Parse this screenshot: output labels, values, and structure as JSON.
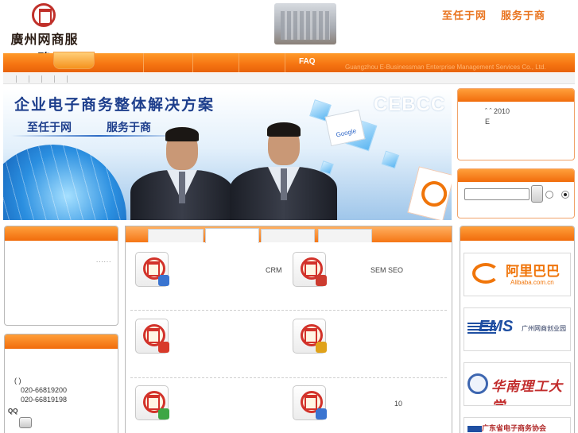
{
  "header": {
    "logo_text": "廣州网商服務",
    "slogan": [
      "至任于网",
      "服务于商"
    ]
  },
  "nav": {
    "faq": "FAQ",
    "tagline": "Guangzhou E-Businessman Enterprise Management Services Co., Ltd."
  },
  "banner": {
    "title": "企业电子商务整体解决方案",
    "sub": [
      "至任于网",
      "服务于商"
    ],
    "watermark": "CEBCC",
    "google": "Google"
  },
  "news": {
    "line1": "ˆ ˆ 2010",
    "line2": "E"
  },
  "left": {
    "more": "......",
    "contact_paren": "(    )",
    "phone1": "020-66819200",
    "phone2": "020-66819198",
    "qq": "QQ"
  },
  "services": [
    {
      "label": "",
      "badge": "#3a74d0"
    },
    {
      "label": "CRM",
      "badge": "#cc3b2f"
    },
    {
      "label": "SEM SEO",
      "badge": "#3a74d0"
    },
    {
      "label": "",
      "badge": "#d83a2a"
    },
    {
      "label": "",
      "badge": "#e0a21a"
    },
    {
      "label": "",
      "badge": "#3ea645"
    },
    {
      "label": "10",
      "badge": "#3a74d0"
    }
  ],
  "links": {
    "ali_name": "阿里巴巴",
    "ali_sub": "Alibaba.com.cn",
    "ems_name": "EMS",
    "ems_sub": "广州网商创业园",
    "uni_name": "华南理工大学",
    "last_name": "广东省电子商务协会"
  },
  "colors": {
    "accent": "#f57311",
    "slogan": "#e9741f",
    "brand_red": "#c0302a"
  }
}
